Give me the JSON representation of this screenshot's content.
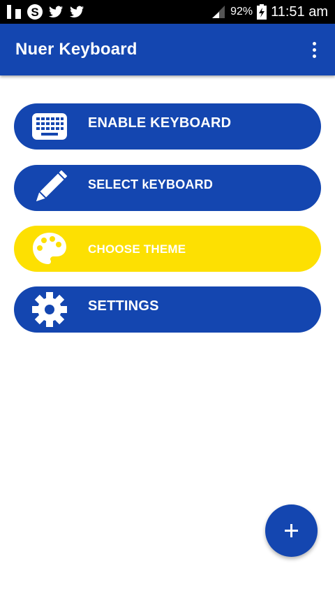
{
  "status_bar": {
    "icons": [
      "flipboard-icon",
      "skype-icon",
      "twitter-icon",
      "twitter-icon"
    ],
    "battery_percent": "92%",
    "time": "11:51 am"
  },
  "app_bar": {
    "title": "Nuer Keyboard",
    "menu_icon": "more-vert-icon"
  },
  "menu": [
    {
      "label": "ENABLE KEYBOARD",
      "icon": "keyboard-icon",
      "color": "#1446b0"
    },
    {
      "label": "SELECT kEYBOARD",
      "icon": "pencil-icon",
      "color": "#1446b0"
    },
    {
      "label": "CHOOSE THEME",
      "icon": "palette-icon",
      "color": "#fde002"
    },
    {
      "label": "SETTINGS",
      "icon": "gear-icon",
      "color": "#1446b0"
    }
  ],
  "fab": {
    "icon": "plus-icon",
    "color": "#1446b0"
  },
  "colors": {
    "primary": "#1446b0",
    "accent_yellow": "#fde002",
    "status_bar": "#000000"
  }
}
